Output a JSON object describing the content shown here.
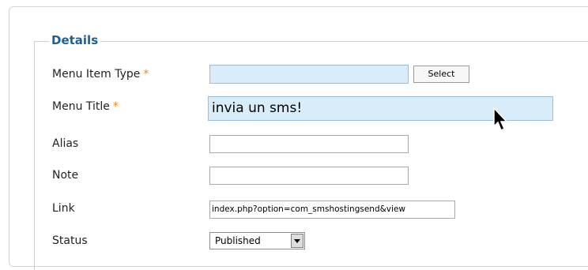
{
  "details": {
    "legend": "Details",
    "fields": {
      "menu_item_type": {
        "label": "Menu Item Type",
        "required": "*",
        "value": "",
        "button_label": "Select"
      },
      "menu_title": {
        "label": "Menu Title",
        "required": "*",
        "value": "invia un sms!"
      },
      "alias": {
        "label": "Alias",
        "value": ""
      },
      "note": {
        "label": "Note",
        "value": ""
      },
      "link": {
        "label": "Link",
        "value": "index.php?option=com_smshostingsend&view"
      },
      "status": {
        "label": "Status",
        "value": "Published"
      }
    }
  },
  "icons": {
    "cursor": "mouse-pointer-icon",
    "dropdown": "chevron-down-icon"
  },
  "colors": {
    "legend": "#1f5e95",
    "required_star": "#ee8b20",
    "highlight_input": "#d8ecfa"
  }
}
